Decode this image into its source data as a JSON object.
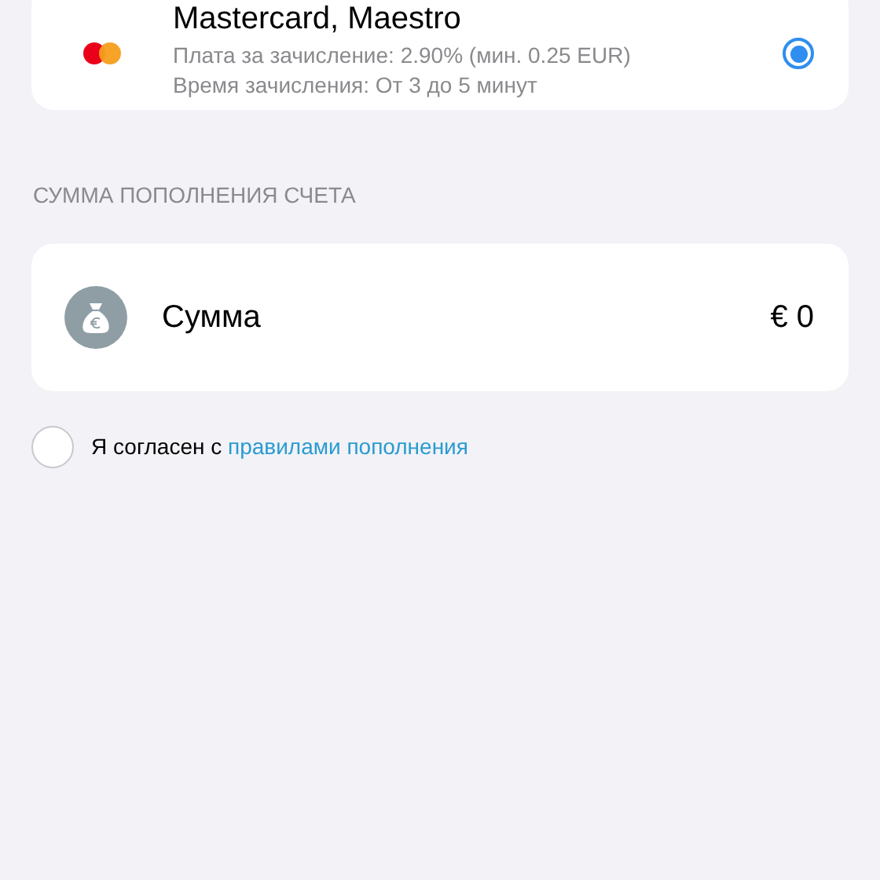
{
  "payment_method": {
    "title": "Mastercard, Maestro",
    "fee": "Плата за зачисление: 2.90% (мин. 0.25 EUR)",
    "time": "Время зачисления: От 3 до 5 минут",
    "selected": true
  },
  "section_header": "СУММА ПОПОЛНЕНИЯ СЧЕТА",
  "amount": {
    "label": "Сумма",
    "value": "€ 0"
  },
  "agreement": {
    "checked": false,
    "text": "Я согласен с ",
    "link": "правилами пополнения"
  }
}
